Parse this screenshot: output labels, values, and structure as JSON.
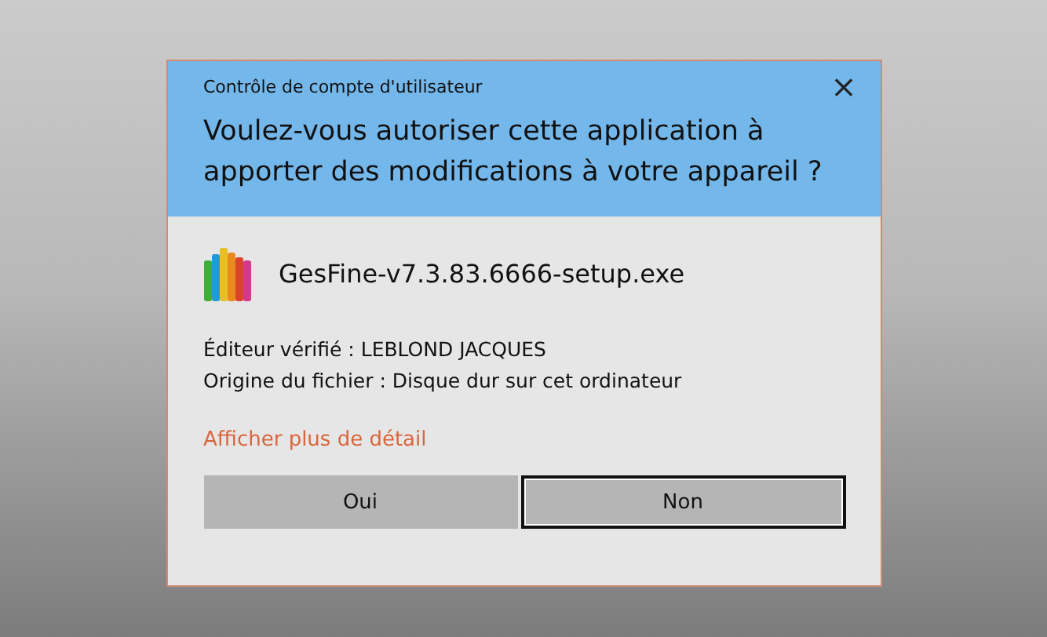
{
  "window": {
    "title": "Contrôle de compte d'utilisateur",
    "close": "×"
  },
  "question": "Voulez-vous autoriser cette application à apporter des modifications à votre appareil ?",
  "program": {
    "name": "GesFine-v7.3.83.6666-setup.exe"
  },
  "details": [
    "Éditeur vérifié : LEBLOND JACQUES",
    "Origine du fichier : Disque dur sur cet ordinateur"
  ],
  "more_link": "Afficher plus de détail",
  "buttons": [
    {
      "label": "Oui",
      "selected": false
    },
    {
      "label": "Non",
      "selected": true
    }
  ]
}
